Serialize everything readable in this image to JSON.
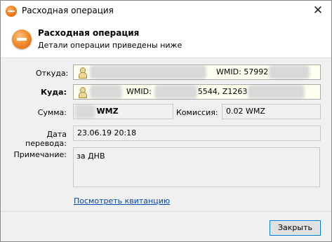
{
  "window": {
    "title": "Расходная операция"
  },
  "header": {
    "title": "Расходная операция",
    "subtitle": "Детали операции приведены ниже"
  },
  "fields": {
    "from_label": "Откуда:",
    "from_wmid": "WMID: 57992",
    "to_label": "Куда:",
    "to_wmid": "WMID:",
    "to_purse": "5544, Z1263",
    "amount_label": "Сумма:",
    "amount_currency": "WMZ",
    "commission_label": "Комиссия:",
    "commission_value": "0.02 WMZ",
    "date_label": "Дата перевода:",
    "date_value": "23.06.19 20:18",
    "note_label": "Примечание:",
    "note_value": "за ДНВ"
  },
  "receipt_link": "Посмотреть квитанцию",
  "buttons": {
    "close": "Закрыть"
  },
  "icons": {
    "title_icon": "webmoney-expense-icon",
    "header_icon": "expense-minus-icon",
    "close": "close-icon",
    "person": "person-icon"
  },
  "colors": {
    "accent": "#ef7a1a",
    "link": "#0645ad",
    "button_border": "#0078d7"
  }
}
